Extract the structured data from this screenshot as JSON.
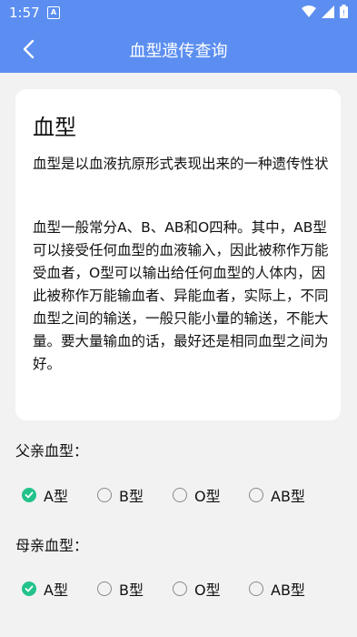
{
  "status": {
    "time": "1:57",
    "notif_glyph": "A"
  },
  "appbar": {
    "title": "血型遗传查询"
  },
  "card": {
    "heading": "血型",
    "subtitle": "血型是以血液抗原形式表现出来的一种遗传性状",
    "body": "血型一般常分A、B、AB和O四种。其中，AB型可以接受任何血型的血液输入，因此被称作万能受血者，O型可以输出给任何血型的人体内，因此被称作万能输血者、异能血者，实际上，不同血型之间的输送，一般只能小量的输送，不能大量。要大量输血的话，最好还是相同血型之间为好。"
  },
  "father": {
    "label": "父亲血型：",
    "options": [
      "A型",
      "B型",
      "O型",
      "AB型"
    ],
    "selected": "A型"
  },
  "mother": {
    "label": "母亲血型：",
    "options": [
      "A型",
      "B型",
      "O型",
      "AB型"
    ],
    "selected": "A型"
  },
  "colors": {
    "accent": "#5b8ef0",
    "check": "#22c38a"
  }
}
